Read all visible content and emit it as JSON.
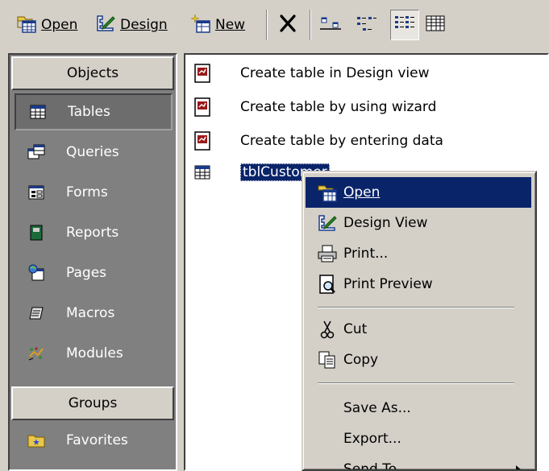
{
  "toolbar": {
    "open_label": "Open",
    "design_label": "Design",
    "new_label": "New",
    "icons": [
      "open-table-icon",
      "design-view-icon",
      "new-object-icon",
      "delete-icon",
      "large-icons-view-icon",
      "small-icons-view-icon",
      "list-view-icon",
      "details-view-icon"
    ]
  },
  "objects_bar": {
    "objects_header": "Objects",
    "items": [
      {
        "label": "Tables",
        "icon": "table-icon",
        "selected": true
      },
      {
        "label": "Queries",
        "icon": "query-icon",
        "selected": false
      },
      {
        "label": "Forms",
        "icon": "form-icon",
        "selected": false
      },
      {
        "label": "Reports",
        "icon": "report-icon",
        "selected": false
      },
      {
        "label": "Pages",
        "icon": "page-icon",
        "selected": false
      },
      {
        "label": "Macros",
        "icon": "macro-icon",
        "selected": false
      },
      {
        "label": "Modules",
        "icon": "module-icon",
        "selected": false
      }
    ],
    "groups_header": "Groups",
    "groups": [
      {
        "label": "Favorites",
        "icon": "favorites-folder-icon"
      }
    ]
  },
  "list": {
    "items": [
      {
        "label": "Create table in Design view",
        "icon": "shortcut-icon"
      },
      {
        "label": "Create table by using wizard",
        "icon": "shortcut-icon"
      },
      {
        "label": "Create table by entering data",
        "icon": "shortcut-icon"
      },
      {
        "label": "tblCustomer",
        "icon": "table-icon",
        "selected": true
      }
    ]
  },
  "context_menu": {
    "items": [
      {
        "label": "Open",
        "icon": "open-table-icon",
        "highlighted": true
      },
      {
        "label": "Design View",
        "icon": "design-view-icon"
      },
      {
        "label": "Print...",
        "icon": "printer-icon"
      },
      {
        "label": "Print Preview",
        "icon": "print-preview-icon"
      },
      {
        "label": "Cut",
        "icon": "scissors-icon"
      },
      {
        "label": "Copy",
        "icon": "copy-icon"
      },
      {
        "label": "Save As...",
        "icon": ""
      },
      {
        "label": "Export...",
        "icon": ""
      },
      {
        "label": "Send To",
        "icon": "",
        "submenu": true
      }
    ]
  },
  "colors": {
    "window_bg": "#d4d0c8",
    "objects_bar_bg": "#808080",
    "highlight": "#0a246a"
  }
}
